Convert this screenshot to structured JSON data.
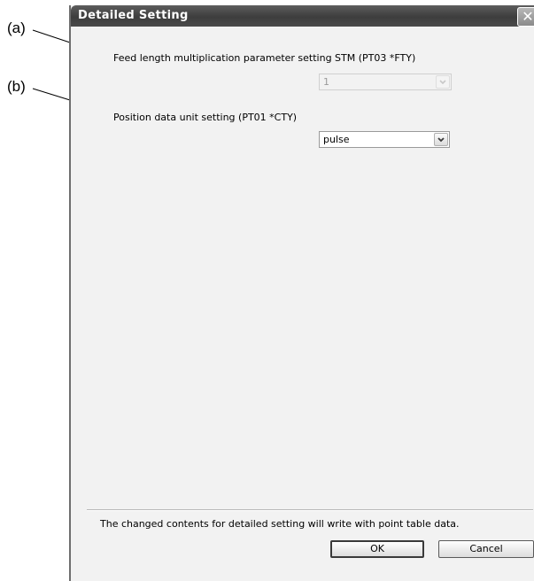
{
  "callouts": {
    "a": "(a)",
    "b": "(b)"
  },
  "window": {
    "title": "Detailed Setting",
    "close_glyph": "✕"
  },
  "settings": {
    "feed_length_label": "Feed length multiplication parameter setting STM (PT03 *FTY)",
    "feed_length_value": "1",
    "feed_length_enabled": false,
    "position_unit_label": "Position data unit setting (PT01 *CTY)",
    "position_unit_value": "pulse",
    "position_unit_enabled": true
  },
  "footer": {
    "note": "The changed contents for detailed setting will write with point table data.",
    "ok_label": "OK",
    "cancel_label": "Cancel"
  },
  "colors": {
    "titlebar": "#4a4a4a",
    "dialog_bg": "#f2f2f2"
  }
}
